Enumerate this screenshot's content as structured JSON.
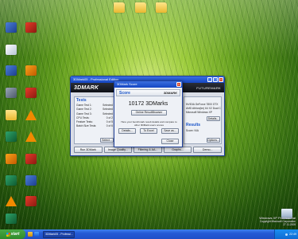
{
  "desktop": {
    "left_icons": [
      {
        "label": "",
        "icon": "app1"
      },
      {
        "label": "",
        "icon": "app2"
      },
      {
        "label": "",
        "icon": "app6"
      },
      {
        "label": "",
        "icon": "app1"
      },
      {
        "label": "",
        "icon": "app3"
      },
      {
        "label": "",
        "icon": "app5"
      },
      {
        "label": "",
        "icon": "app2"
      },
      {
        "label": "",
        "icon": "folder"
      },
      {
        "label": "",
        "icon": "vlc"
      },
      {
        "label": "",
        "icon": "app4"
      },
      {
        "label": "",
        "icon": "vlc"
      },
      {
        "label": "",
        "icon": "app3"
      },
      {
        "label": "",
        "icon": "app2"
      },
      {
        "label": "",
        "icon": "app4"
      },
      {
        "label": "",
        "icon": "app1"
      },
      {
        "label": "",
        "icon": "vlc"
      },
      {
        "label": "",
        "icon": "app2"
      },
      {
        "label": "",
        "icon": "app4"
      },
      {
        "label": "",
        "icon": "recycle"
      }
    ],
    "top_icons": [
      {
        "label": "",
        "icon": "folder"
      },
      {
        "label": "",
        "icon": "folder"
      },
      {
        "label": "",
        "icon": "folder"
      }
    ]
  },
  "main_window": {
    "title": "3DMark05 - Professional Edition",
    "brand": "3DMARK",
    "brand_sub": "FUTUREMARK",
    "tests": {
      "heading": "Tests",
      "rows": [
        {
          "name": "Game Test 1:",
          "value": "Selected"
        },
        {
          "name": "Game Test 2:",
          "value": "Selected"
        },
        {
          "name": "Game Test 3:",
          "value": "Selected"
        },
        {
          "name": "CPU Tests:",
          "value": "0 of 2"
        },
        {
          "name": "Feature Tests:",
          "value": "0 of 5"
        },
        {
          "name": "Batch Size Tests:",
          "value": "0 of 6"
        }
      ],
      "select_label": "Select..."
    },
    "system": {
      "lines": [
        "NVIDIA GeForce 7800 GTX",
        "AMD Athlon(tm) 64 X2 Dual Core",
        "Microsoft Windows XP"
      ],
      "details_label": "Details...",
      "results_heading": "Results",
      "results_line": "Score:           N/A",
      "options_label": "Options..."
    },
    "bottom_buttons": [
      "Run 3DMark",
      "Image Quality...",
      "Filtering & AA...",
      "Graphs...",
      "Demo..."
    ]
  },
  "score_dialog": {
    "title": "3DMark Score",
    "score_label": "Score",
    "logo": "3DMARK",
    "score_value": "10172 3DMarks",
    "online_button": "Online ResultBrowser",
    "info_text": "Here your benchmark result details and compare to other 3DMark users scores",
    "details_button": "Details...",
    "excel_button": "To Excel",
    "save_button": "Save as...",
    "close_button": "Close"
  },
  "taskbar": {
    "start_label": "start",
    "task_label": "3DMark05 - Professi...",
    "clock": "22:49"
  },
  "watermark": {
    "brand": "Windows XP Professional",
    "build": "Copyright Microsoft Corporation",
    "date": "27.11.2005"
  }
}
